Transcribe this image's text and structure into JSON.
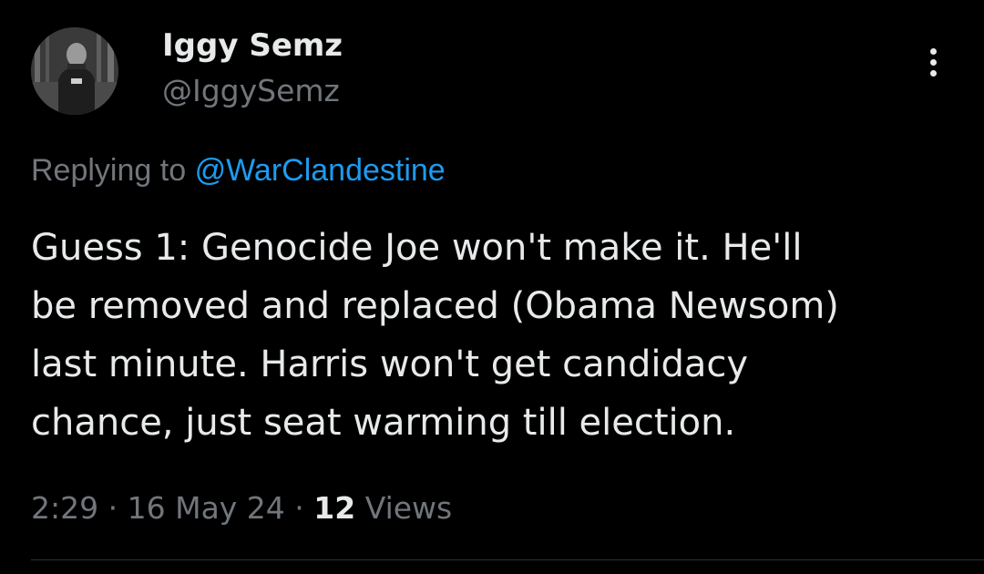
{
  "author": {
    "display_name": "Iggy Semz",
    "handle": "@IggySemz"
  },
  "reply": {
    "prefix": "Replying to",
    "mention": "@WarClandestine"
  },
  "tweet": {
    "text": "Guess 1: Genocide Joe won't make it. He'll\nbe removed and replaced (Obama Newsom)\nlast minute. Harris won't get candidacy\nchance, just seat warming till election."
  },
  "meta": {
    "time": "2:29",
    "separator": "·",
    "date": "16 May 24",
    "views_count": "12",
    "views_label": "Views"
  },
  "icons": {
    "more": "more-vertical-icon",
    "avatar": "profile-photo"
  },
  "colors": {
    "background": "#000000",
    "primary_text": "#e7e9ea",
    "secondary_text": "#71767b",
    "accent": "#1d9bf0",
    "divider": "#2f3336"
  }
}
